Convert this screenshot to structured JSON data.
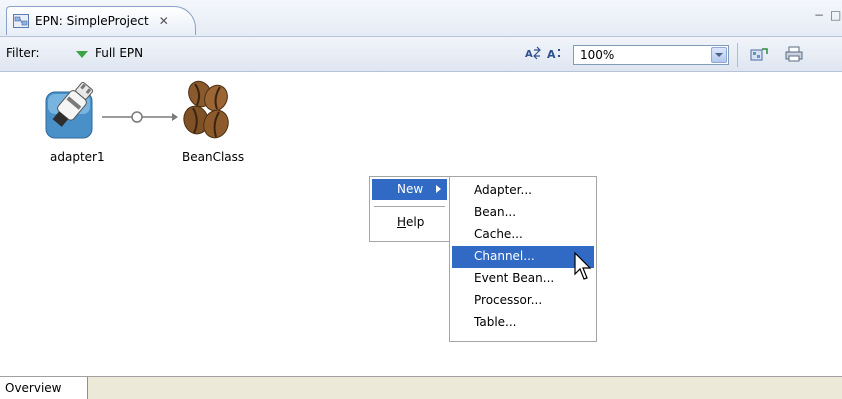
{
  "editor_tab": {
    "title": "EPN: SimpleProject",
    "close_glyph": "✕"
  },
  "window_controls": {
    "minimize": "−",
    "maximize": "□"
  },
  "toolbar": {
    "filter_label": "Filter:",
    "filter_value": "Full EPN",
    "zoom_value": "100%",
    "icons": [
      "layout-icon",
      "font-icon",
      "export-icon",
      "print-icon"
    ]
  },
  "canvas": {
    "nodes": [
      {
        "label": "adapter1",
        "icon": "adapter-plug-icon"
      },
      {
        "label": "BeanClass",
        "icon": "coffee-bean-icon"
      }
    ]
  },
  "context_menu": {
    "items": [
      {
        "label": "New",
        "has_submenu": true,
        "selected": true
      },
      {
        "label": "Help",
        "mnemonic": "H",
        "selected": false
      }
    ]
  },
  "submenu": {
    "items": [
      {
        "label": "Adapter..."
      },
      {
        "label": "Bean..."
      },
      {
        "label": "Cache..."
      },
      {
        "label": "Channel...",
        "selected": true
      },
      {
        "label": "Event Bean..."
      },
      {
        "label": "Processor..."
      },
      {
        "label": "Table..."
      }
    ]
  },
  "bottom_tabs": [
    {
      "label": "Overview"
    }
  ],
  "colors": {
    "selection": "#316ac5",
    "filter_icon": "#3aa347",
    "tab_border": "#8aa2c6"
  }
}
